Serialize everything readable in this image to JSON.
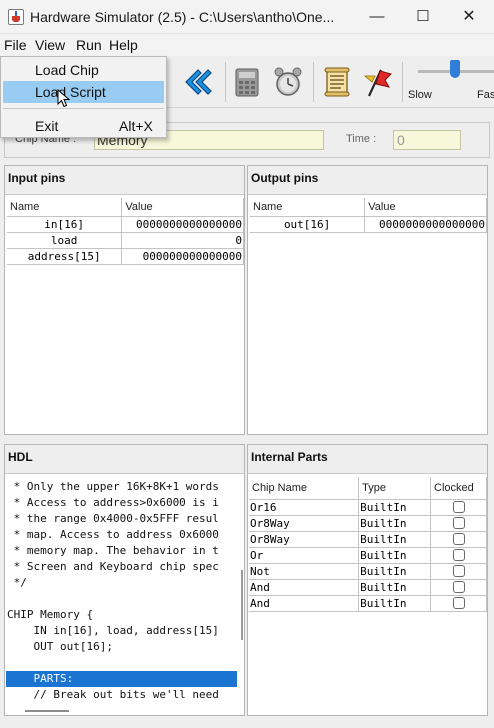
{
  "window": {
    "title": "Hardware Simulator (2.5) - C:\\Users\\antho\\One...",
    "min_glyph": "—",
    "max_glyph": "☐",
    "close_glyph": "✕"
  },
  "menubar": {
    "file": "File",
    "view": "View",
    "run": "Run",
    "help": "Help"
  },
  "file_menu": {
    "load_chip": "Load Chip",
    "load_script": "Load Script",
    "exit": "Exit",
    "exit_accel": "Alt+X"
  },
  "toolbar": {
    "icons": [
      "reset-icon",
      "calculator-icon",
      "clock-icon",
      "script-icon",
      "breakpoint-flag-icon"
    ],
    "speed_slow": "Slow",
    "speed_fast": "Fast",
    "speed_level": 0.45
  },
  "chip": {
    "name_label": "Chip Name :",
    "name_value": "Memory",
    "time_label": "Time :",
    "time_value": "0"
  },
  "input_pins": {
    "title": "Input pins",
    "col_name": "Name",
    "col_value": "Value",
    "rows": [
      {
        "name": "in[16]",
        "value": "0000000000000000"
      },
      {
        "name": "load",
        "value": "0"
      },
      {
        "name": "address[15]",
        "value": "000000000000000"
      }
    ]
  },
  "output_pins": {
    "title": "Output pins",
    "col_name": "Name",
    "col_value": "Value",
    "rows": [
      {
        "name": "out[16]",
        "value": "0000000000000000"
      }
    ]
  },
  "hdl": {
    "title": "HDL",
    "lines": [
      " * Only the upper 16K+8K+1 words",
      " * Access to address>0x6000 is i",
      " * the range 0x4000-0x5FFF resul",
      " * map. Access to address 0x6000",
      " * memory map. The behavior in t",
      " * Screen and Keyboard chip spec",
      " */",
      "",
      "CHIP Memory {",
      "    IN in[16], load, address[15]",
      "    OUT out[16];",
      "",
      "    PARTS:",
      "    // Break out bits we'll need"
    ],
    "selected_line": 12
  },
  "internal_parts": {
    "title": "Internal Parts",
    "col_name": "Chip Name",
    "col_type": "Type",
    "col_clocked": "Clocked",
    "rows": [
      {
        "name": "Or16",
        "type": "BuiltIn",
        "clocked": false
      },
      {
        "name": "Or8Way",
        "type": "BuiltIn",
        "clocked": false
      },
      {
        "name": "Or8Way",
        "type": "BuiltIn",
        "clocked": false
      },
      {
        "name": "Or",
        "type": "BuiltIn",
        "clocked": false
      },
      {
        "name": "Not",
        "type": "BuiltIn",
        "clocked": false
      },
      {
        "name": "And",
        "type": "BuiltIn",
        "clocked": false
      },
      {
        "name": "And",
        "type": "BuiltIn",
        "clocked": false
      }
    ]
  },
  "colors": {
    "selection": "#1b74d1",
    "menu_hover": "#99ccf3",
    "slider_thumb": "#2f7fd9",
    "field_bg": "#f7f7d9"
  }
}
